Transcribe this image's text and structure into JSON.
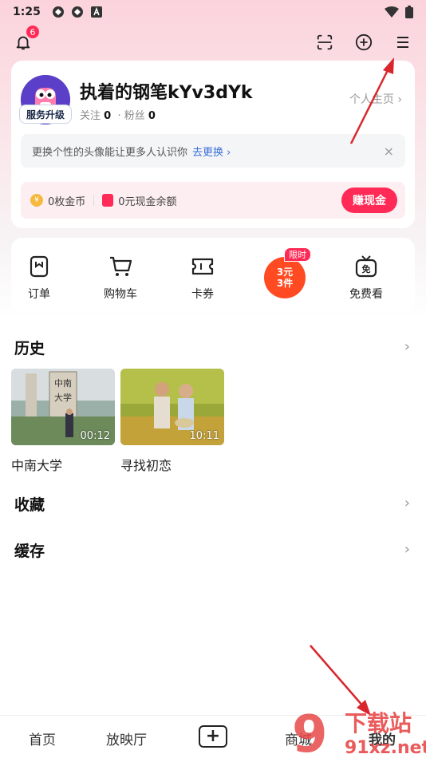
{
  "status_bar": {
    "time": "1:25"
  },
  "notifications": {
    "badge_count": "6"
  },
  "profile": {
    "username": "执着的钢笔kYv3dYk",
    "upgrade_tag": "服务升级",
    "following_label": "关注",
    "following_count": "0",
    "followers_label": "· 粉丝",
    "followers_count": "0",
    "homepage_link": "个人主页 ›"
  },
  "tip": {
    "text": "更换个性的头像能让更多人认识你",
    "action": "去更换 ›",
    "close": "×"
  },
  "wallet": {
    "coins": "0枚金币",
    "cash": "0元现金余额",
    "earn_button": "赚现金"
  },
  "quick_links": [
    {
      "label": "订单",
      "icon": "receipt-icon"
    },
    {
      "label": "购物车",
      "icon": "cart-icon"
    },
    {
      "label": "卡券",
      "icon": "ticket-icon"
    },
    {
      "label": "免费看",
      "icon": "tv-free-icon"
    }
  ],
  "promo": {
    "line1": "3元",
    "line2": "3件",
    "tag": "限时"
  },
  "history": {
    "title": "历史",
    "videos": [
      {
        "title": "中南大学",
        "duration": "00:12"
      },
      {
        "title": "寻找初恋",
        "duration": "10:11"
      }
    ]
  },
  "favorites": {
    "title": "收藏"
  },
  "cache": {
    "title": "缓存"
  },
  "bottom_nav": {
    "home": "首页",
    "theater": "放映厅",
    "add": "+",
    "mall": "商城",
    "me": "我的"
  },
  "watermark": {
    "line1": "下载站",
    "line2": "91xz.net",
    "mark": "9"
  },
  "colors": {
    "accent": "#ff2a55",
    "link": "#3a6fd8",
    "annotation_arrow": "#d9262c"
  }
}
